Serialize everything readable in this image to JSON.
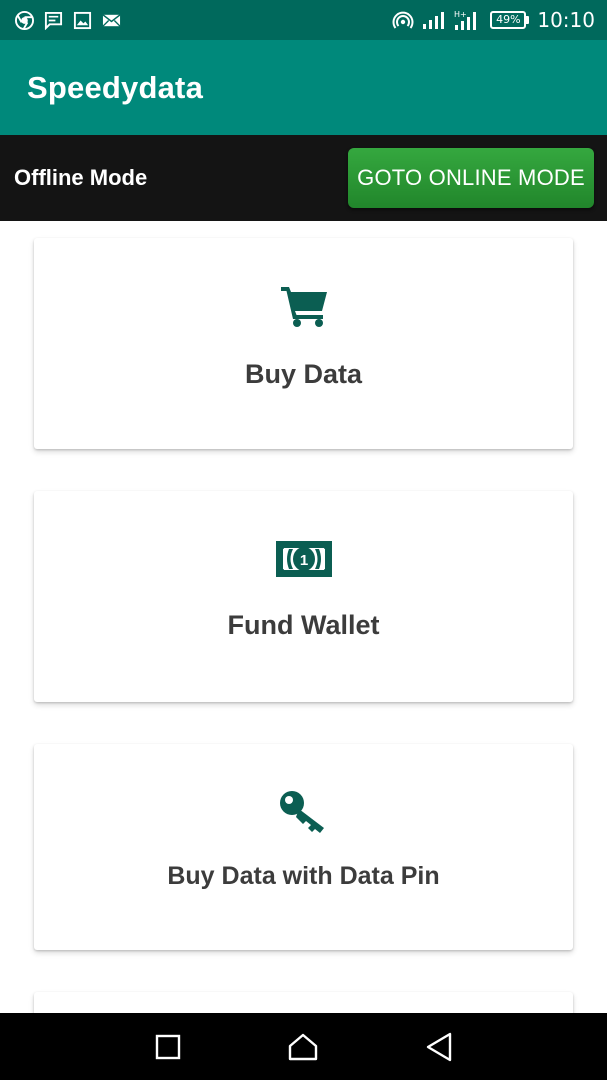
{
  "status_bar": {
    "battery_level": "49%",
    "time": "10:10",
    "left_icons": [
      "chrome-icon",
      "message-icon",
      "image-icon",
      "mail-icon"
    ],
    "right_icons": [
      "hotspot-icon",
      "signal-icon",
      "signal-h-icon"
    ]
  },
  "app_bar": {
    "title": "Speedydata"
  },
  "banner": {
    "mode_label": "Offline Mode",
    "online_button": "GOTO ONLINE MODE",
    "button_color": "#2e9e3a"
  },
  "menu": [
    {
      "label": "Buy Data",
      "icon": "cart-icon"
    },
    {
      "label": "Fund Wallet",
      "icon": "money-icon"
    },
    {
      "label": "Buy Data with Data Pin",
      "icon": "key-icon"
    }
  ],
  "colors": {
    "status_bar": "#00695c",
    "app_bar": "#00897b",
    "icon": "#0b5e52"
  },
  "nav_bar": [
    "recents-button",
    "home-button",
    "back-button"
  ]
}
